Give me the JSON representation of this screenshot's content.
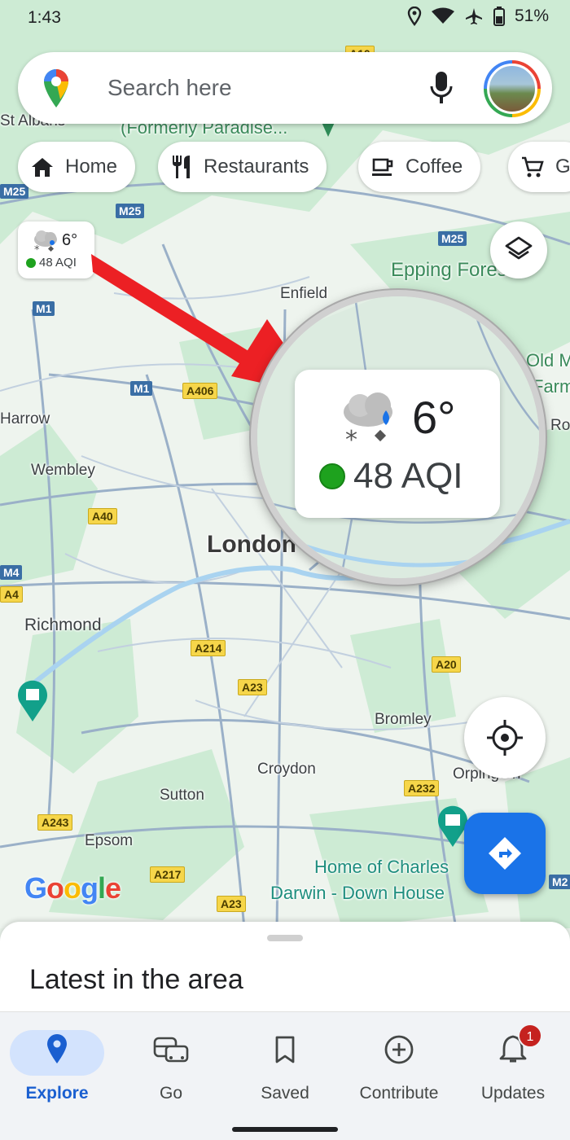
{
  "status_bar": {
    "time": "1:43",
    "battery": "51%"
  },
  "search": {
    "placeholder": "Search here"
  },
  "chips": [
    {
      "label": "Home",
      "icon": "home-icon"
    },
    {
      "label": "Restaurants",
      "icon": "restaurant-icon"
    },
    {
      "label": "Coffee",
      "icon": "coffee-icon"
    },
    {
      "label": "G",
      "icon": "cart-icon"
    }
  ],
  "weather_chip": {
    "temperature": "6°",
    "aqi": "48 AQI"
  },
  "magnified_weather": {
    "temperature": "6°",
    "aqi": "48 AQI"
  },
  "map": {
    "places": [
      "St Albans",
      "(Formerly Paradise...",
      "Epping Fores",
      "Enfield",
      "Harrow",
      "Wembley",
      "London",
      "Richmond",
      "Bromley",
      "Croydon",
      "Sutton",
      "Epsom",
      "Orpington",
      "Home of Charles",
      "Darwin - Down House",
      "Old M",
      "Farm",
      "Ro"
    ],
    "roads": [
      "M25",
      "M25",
      "M25",
      "M1",
      "M1",
      "A406",
      "A40",
      "M4",
      "A4",
      "A214",
      "A23",
      "A20",
      "A232",
      "A243",
      "A217",
      "A23",
      "M2",
      "A10"
    ]
  },
  "logo": {
    "text": "Google"
  },
  "sheet": {
    "title": "Latest in the area"
  },
  "nav": {
    "items": [
      {
        "label": "Explore",
        "icon": "explore-pin-icon",
        "active": true
      },
      {
        "label": "Go",
        "icon": "commute-icon"
      },
      {
        "label": "Saved",
        "icon": "bookmark-icon"
      },
      {
        "label": "Contribute",
        "icon": "add-circle-icon"
      },
      {
        "label": "Updates",
        "icon": "bell-icon",
        "badge": "1"
      }
    ]
  }
}
